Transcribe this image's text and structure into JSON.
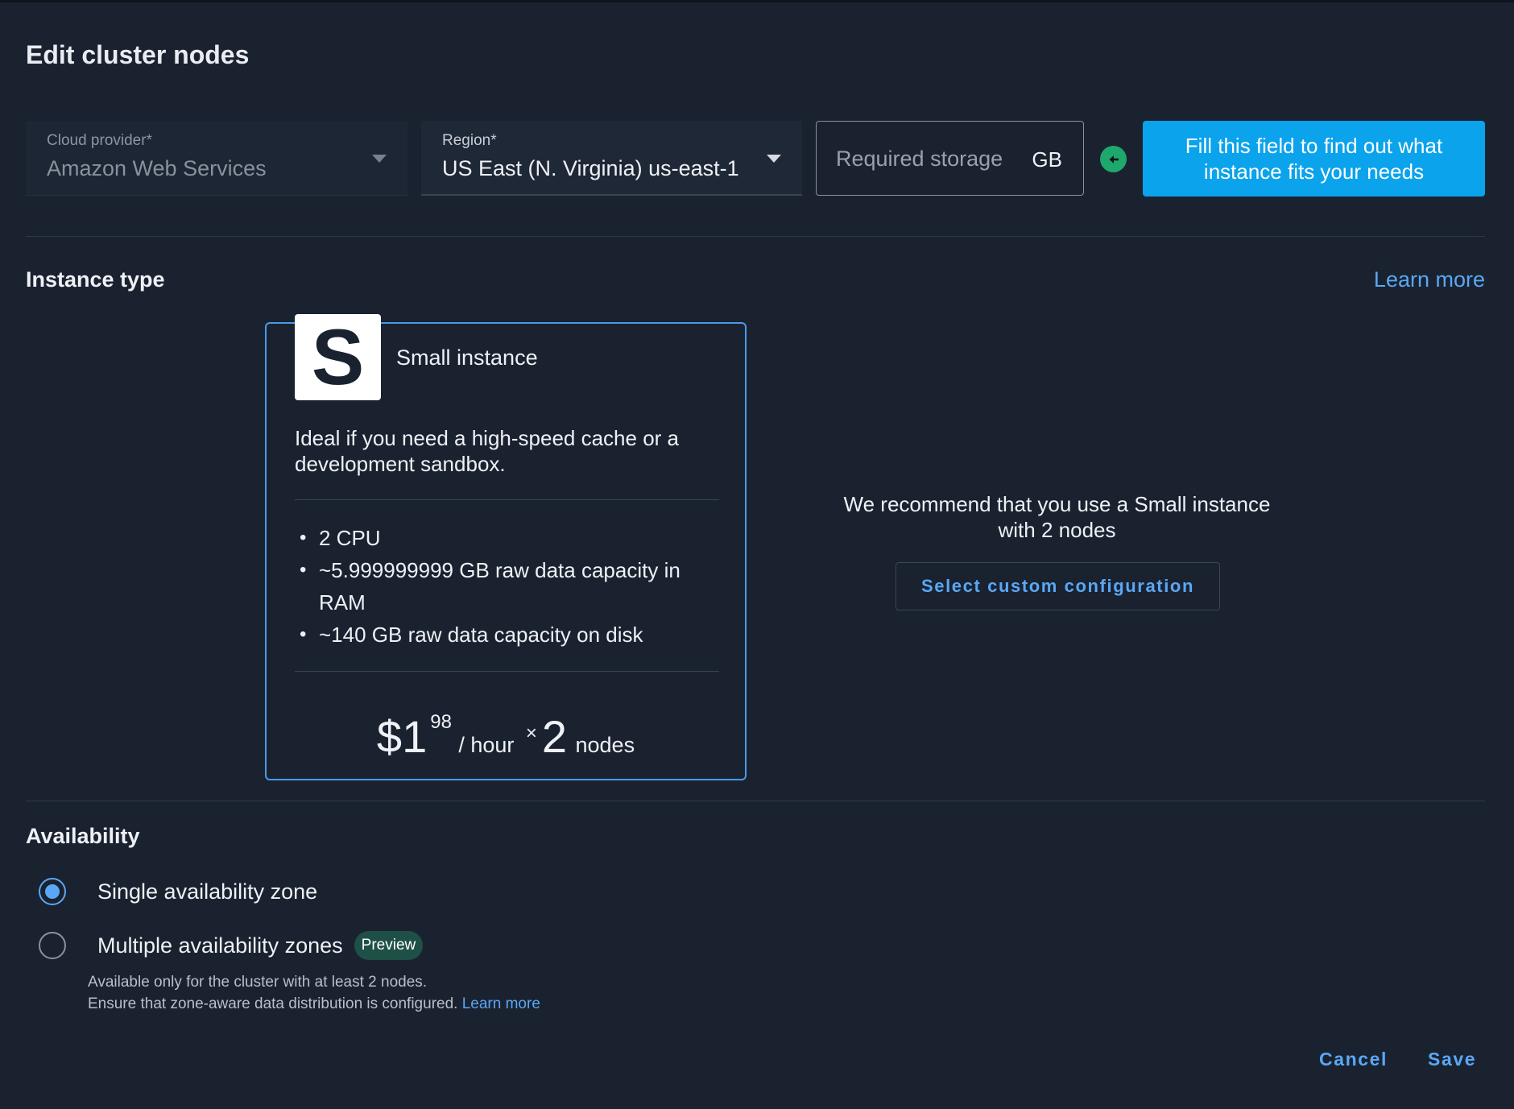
{
  "dialog": {
    "title": "Edit cluster nodes"
  },
  "provider": {
    "label": "Cloud provider*",
    "value": "Amazon Web Services"
  },
  "region": {
    "label": "Region*",
    "value": "US East (N. Virginia) us-east-1"
  },
  "storage": {
    "placeholder": "Required storage",
    "unit": "GB"
  },
  "hint_button": {
    "label": "Fill this field to find out what instance fits your needs"
  },
  "instance_section": {
    "title": "Instance type",
    "learn_more": "Learn more"
  },
  "instance_card": {
    "letter": "S",
    "name": "Small instance",
    "description": "Ideal if you need a high-speed cache or a development sandbox.",
    "specs": [
      "2 CPU",
      "~5.999999999 GB raw data capacity in RAM",
      "~140 GB raw data capacity on disk"
    ],
    "price": {
      "currency_whole": "$1",
      "cents": "98",
      "per": "/ hour",
      "times": "×",
      "count": "2",
      "unit": "nodes"
    }
  },
  "recommendation": {
    "text": "We recommend that you use a Small instance with 2 nodes",
    "custom_button": "Select custom configuration"
  },
  "availability": {
    "title": "Availability",
    "options": [
      {
        "label": "Single availability zone",
        "checked": true
      },
      {
        "label": "Multiple availability zones",
        "checked": false,
        "badge": "Preview"
      }
    ],
    "note_line1": "Available only for the cluster with at least 2 nodes.",
    "note_line2": "Ensure that zone-aware data distribution is configured.",
    "note_link": "Learn more"
  },
  "footer": {
    "cancel": "Cancel",
    "save": "Save"
  },
  "colors": {
    "accent": "#5aa7f5",
    "primary_button": "#0aa3ec",
    "badge_bg": "#1e5048",
    "arrow_badge": "#1fa86b"
  }
}
